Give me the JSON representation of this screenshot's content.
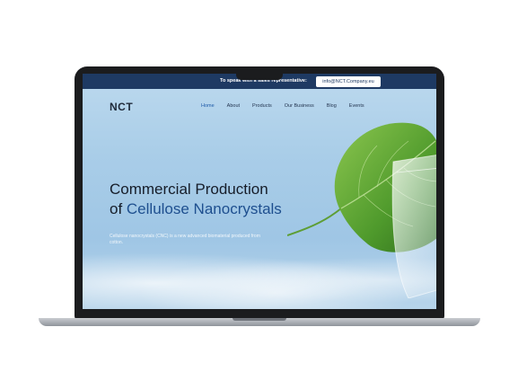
{
  "topbar": {
    "contact_text": "To speak with a sales representative:",
    "email": "info@NCT.Company.eu"
  },
  "brand": {
    "logo": "NCT"
  },
  "nav": {
    "items": [
      {
        "label": "Home",
        "active": true
      },
      {
        "label": "About"
      },
      {
        "label": "Products"
      },
      {
        "label": "Our Business"
      },
      {
        "label": "Blog"
      },
      {
        "label": "Events"
      }
    ]
  },
  "hero": {
    "line1": "Commercial Production",
    "line2_prefix": "of ",
    "line2_accent": "Cellulose Nanocrystals",
    "subtitle": "Cellulose nanocrystals (CNC) is a new advanced biomaterial produced from cotton."
  },
  "colors": {
    "topbar_bg": "#1e3a63",
    "accent_blue": "#1e4f8f",
    "sky": "#a9cde8",
    "leaf_green": "#4f9a2c"
  }
}
